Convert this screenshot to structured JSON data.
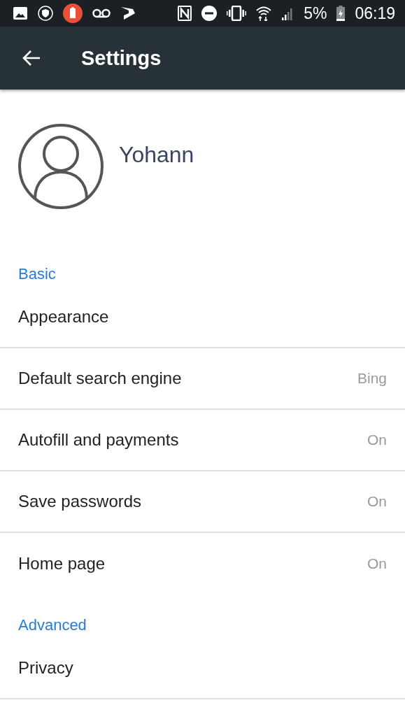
{
  "status_bar": {
    "battery": "5%",
    "time": "06:19"
  },
  "app_bar": {
    "title": "Settings"
  },
  "profile": {
    "name": "Yohann"
  },
  "sections": [
    {
      "header": "Basic",
      "items": [
        {
          "label": "Appearance"
        },
        {
          "label": "Default search engine",
          "value": "Bing"
        },
        {
          "label": "Autofill and payments",
          "value": "On"
        },
        {
          "label": "Save passwords",
          "value": "On"
        },
        {
          "label": "Home page",
          "value": "On"
        }
      ]
    },
    {
      "header": "Advanced",
      "items": [
        {
          "label": "Privacy"
        }
      ]
    }
  ]
}
